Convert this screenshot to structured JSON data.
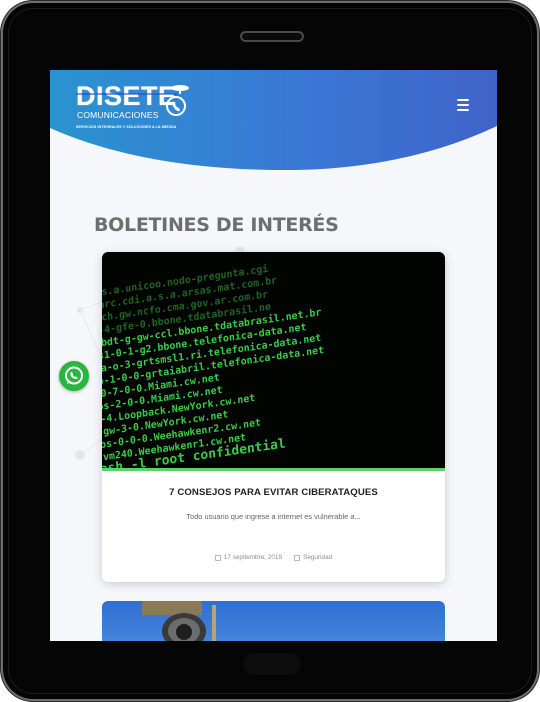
{
  "brand": {
    "name": "DISETE",
    "subtitle": "COMUNICACIONES",
    "tagline": "SERVICIOS INTEGRALES Y SOLUCIONES A LA MEDIDA"
  },
  "section": {
    "title": "BOLETINES DE INTERÉS"
  },
  "posts": [
    {
      "title": "7 CONSEJOS PARA EVITAR CIBERATAQUES",
      "excerpt": "Todo usuario que ingrese a internet es vulnerable a...",
      "date": "17 septiembre, 2019",
      "category": "Seguridad"
    }
  ],
  "terminal_lines": [
    "cl.s.a.unicoo.nodo-pregunta.cgi",
    "nbarc.cdi.a.s.a.arsas.mat.com.br",
    "arch.gw.ncfo.cma.gov.ar.com.br",
    "gt-4-gfe-0.bbone.tdatabrasil.ne",
    "arbdt-g-gw-ccl.bbone.tdatabrasil.net.br",
    "as1-0-1-g2.bbone.telefonica-data.net",
    "gsa-o-3-grtsmsl1.ri.telefonica-data.net",
    "so-1-0-0-grtaiabril.telefonica-data.net",
    "S0-7-0-0.Miami.cw.net",
    "ios-2-0-0.Miami.cw.net",
    "9-4.Loopback.NewYork.cw.net",
    "-gw-3-0.NewYork.cw.net",
    "pos-0-0-0.Weehawkenr2.cw.net",
    "-vm240.Weehawkenr1.cw.net",
    "ash -l root confidential"
  ],
  "colors": {
    "header_gradient_start": "#2b8fd0",
    "header_gradient_end": "#3f6fd2",
    "terminal_green": "#3cd64a",
    "whatsapp_green": "#2ab540"
  }
}
